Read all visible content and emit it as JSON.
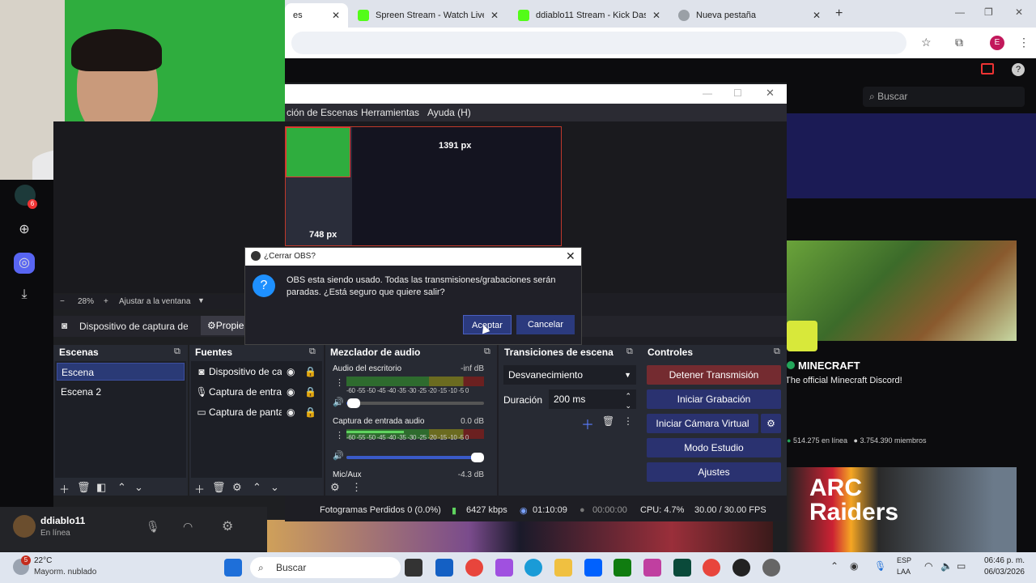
{
  "browser": {
    "tabs": [
      {
        "title": "es",
        "active": true
      },
      {
        "title": "Spreen Stream - Watch Live on",
        "active": false
      },
      {
        "title": "ddiablo11 Stream - Kick Dashb",
        "active": false
      },
      {
        "title": "Nueva pestaña",
        "active": false
      }
    ],
    "avatar_letter": "E",
    "window_controls": [
      "—",
      "❐",
      "✕"
    ]
  },
  "kick": {
    "search_placeholder": "Buscar",
    "badge_count": "6",
    "community": {
      "name": "MINECRAFT",
      "description": "The official Minecraft Discord!",
      "online": "514.275 en línea",
      "members": "3.754.390 miembros"
    },
    "banner_text": "ARC Raiders",
    "user": {
      "name": "ddiablo11",
      "status": "En línea"
    }
  },
  "obs": {
    "menu": [
      "ción de Escenas",
      "Herramientas",
      "Ayuda (H)"
    ],
    "preview": {
      "width_label": "1391 px",
      "height_label": "748 px"
    },
    "zoom": {
      "minus": "−",
      "percent": "28%",
      "plus": "+",
      "fit": "Ajustar a la ventana"
    },
    "source_toolbar": {
      "label": "Dispositivo de captura de v",
      "props": "Propie"
    },
    "docks": {
      "scenes": {
        "title": "Escenas",
        "items": [
          "Escena",
          "Escena 2"
        ]
      },
      "sources": {
        "title": "Fuentes",
        "items": [
          "Dispositivo de cap",
          "Captura de entrad",
          "Captura de panta"
        ]
      },
      "mixer": {
        "title": "Mezclador de audio",
        "channels": [
          {
            "name": "Audio del escritorio",
            "db": "-inf dB",
            "level": 0,
            "volume": 0.05
          },
          {
            "name": "Captura de entrada audio",
            "db": "0.0 dB",
            "level": 0.42,
            "volume": 1.0
          },
          {
            "name": "Mic/Aux",
            "db": "-4.3 dB"
          }
        ],
        "scale": "-60 -55 -50 -45 -40 -35 -30 -25 -20 -15 -10 -5 0"
      },
      "transitions": {
        "title": "Transiciones de escena",
        "type": "Desvanecimiento",
        "duration_label": "Duración",
        "duration": "200 ms"
      },
      "controls": {
        "title": "Controles",
        "buttons": [
          "Detener Transmisión",
          "Iniciar Grabación",
          "Iniciar Cámara Virtual",
          "Modo Estudio",
          "Ajustes"
        ]
      }
    },
    "status": {
      "dropped": "Fotogramas Perdidos 0 (0.0%)",
      "bitrate": "6427 kbps",
      "stream_time": "01:10:09",
      "rec_time": "00:00:00",
      "cpu": "CPU: 4.7%",
      "fps": "30.00 / 30.00 FPS"
    }
  },
  "dialog": {
    "title": "¿Cerrar OBS?",
    "message": "OBS esta siendo usado. Todas las transmisiones/grabaciones serán paradas. ¿Está seguro que quiere salir?",
    "ok": "Aceptar",
    "cancel": "Cancelar"
  },
  "taskbar": {
    "weather_temp": "22°C",
    "weather_desc": "Mayorm. nublado",
    "weather_badge": "5",
    "search": "Buscar",
    "lang1": "ESP",
    "lang2": "LAA",
    "time": "06:46 p. m.",
    "date": "06/03/2026"
  }
}
